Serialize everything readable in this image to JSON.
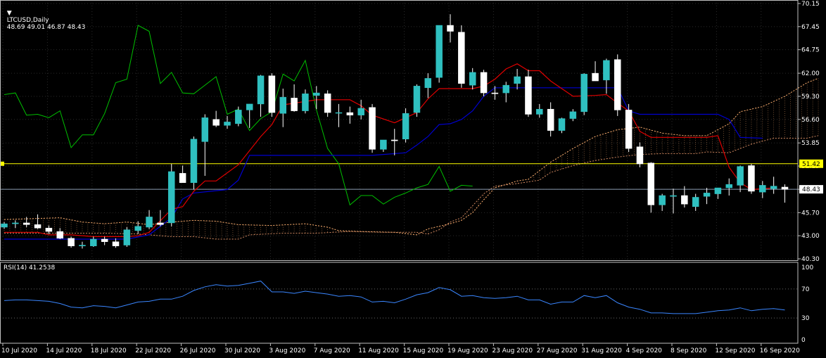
{
  "header": {
    "symbol_label": "LTCUSD,Daily",
    "ohlc_label": "48.69 49.01 46.87 48.43",
    "rsi_label": "RSI(14) 41.2538"
  },
  "colors": {
    "background": "#000000",
    "frame": "#c0c0c0",
    "grid": "#2a2a2a",
    "bull": "#2fc0c0",
    "bear": "#ffffff",
    "tenkan": "#e00000",
    "kijun": "#0000d0",
    "chikou": "#00c000",
    "span_a": "#ffb070",
    "span_b": "#d08860",
    "rsi": "#3a86ff",
    "marker_line": "#ffff00",
    "current_line": "#8a9bb0"
  },
  "price_axis": {
    "ticks": [
      "70.15",
      "67.45",
      "64.75",
      "62.00",
      "59.30",
      "56.60",
      "53.85",
      "51.15",
      "48.43",
      "45.70",
      "43.00",
      "40.30"
    ],
    "marker_label": "51.42",
    "current_label": "48.43"
  },
  "rsi_axis": {
    "ticks": [
      "100",
      "70",
      "30",
      "0"
    ]
  },
  "x_axis": {
    "labels": [
      "10 Jul 2020",
      "14 Jul 2020",
      "18 Jul 2020",
      "22 Jul 2020",
      "26 Jul 2020",
      "30 Jul 2020",
      "3 Aug 2020",
      "7 Aug 2020",
      "11 Aug 2020",
      "15 Aug 2020",
      "19 Aug 2020",
      "23 Aug 2020",
      "27 Aug 2020",
      "31 Aug 2020",
      "4 Sep 2020",
      "8 Sep 2020",
      "12 Sep 2020",
      "16 Sep 2020"
    ]
  },
  "chart_data": {
    "type": "candlestick",
    "title": "LTCUSD,Daily",
    "ylim": [
      40.3,
      70.15
    ],
    "rsi_ylim": [
      0,
      100
    ],
    "horizontal_line": 51.42,
    "current_price": 48.43,
    "ohlc": [
      [
        44.0,
        44.6,
        43.8,
        44.4
      ],
      [
        44.4,
        44.8,
        43.9,
        44.5
      ],
      [
        44.5,
        45.2,
        44.0,
        44.3
      ],
      [
        44.3,
        45.5,
        43.8,
        43.9
      ],
      [
        43.9,
        44.2,
        43.2,
        43.5
      ],
      [
        43.5,
        43.9,
        42.6,
        42.7
      ],
      [
        42.7,
        42.9,
        41.6,
        41.8
      ],
      [
        41.8,
        42.3,
        41.5,
        41.9
      ],
      [
        41.8,
        42.9,
        41.7,
        42.6
      ],
      [
        42.6,
        42.9,
        41.9,
        42.3
      ],
      [
        42.3,
        42.7,
        41.6,
        41.8
      ],
      [
        41.9,
        44.0,
        41.7,
        43.7
      ],
      [
        43.6,
        44.7,
        43.2,
        44.1
      ],
      [
        44.0,
        46.0,
        43.8,
        45.2
      ],
      [
        44.5,
        46.0,
        44.1,
        44.3
      ],
      [
        44.5,
        51.4,
        44.1,
        50.5
      ],
      [
        50.3,
        51.2,
        49.2,
        49.2
      ],
      [
        49.2,
        54.6,
        48.4,
        54.3
      ],
      [
        54.0,
        57.2,
        50.0,
        56.8
      ],
      [
        56.6,
        57.6,
        55.7,
        55.9
      ],
      [
        55.9,
        57.0,
        55.5,
        56.3
      ],
      [
        56.1,
        58.1,
        55.8,
        57.7
      ],
      [
        57.7,
        58.4,
        55.6,
        58.4
      ],
      [
        58.4,
        61.8,
        56.9,
        61.7
      ],
      [
        61.7,
        62.0,
        56.9,
        57.4
      ],
      [
        57.3,
        60.2,
        55.7,
        59.2
      ],
      [
        59.1,
        60.7,
        57.5,
        57.6
      ],
      [
        57.6,
        60.1,
        57.3,
        59.6
      ],
      [
        59.4,
        60.5,
        57.8,
        59.7
      ],
      [
        59.6,
        60.0,
        56.9,
        57.4
      ],
      [
        57.4,
        58.4,
        55.7,
        57.4
      ],
      [
        57.4,
        58.1,
        56.1,
        57.1
      ],
      [
        57.1,
        58.9,
        56.6,
        57.9
      ],
      [
        58.0,
        58.4,
        52.7,
        53.1
      ],
      [
        53.1,
        54.2,
        52.8,
        54.2
      ],
      [
        54.2,
        55.5,
        52.4,
        54.1
      ],
      [
        54.3,
        57.9,
        53.9,
        57.3
      ],
      [
        57.4,
        60.7,
        56.9,
        60.5
      ],
      [
        60.3,
        62.0,
        59.1,
        61.4
      ],
      [
        61.5,
        67.6,
        60.9,
        67.6
      ],
      [
        67.6,
        68.9,
        65.6,
        66.9
      ],
      [
        66.8,
        67.6,
        60.3,
        60.8
      ],
      [
        60.6,
        62.6,
        60.1,
        62.1
      ],
      [
        62.1,
        62.4,
        59.3,
        59.7
      ],
      [
        59.7,
        60.5,
        58.9,
        59.6
      ],
      [
        59.7,
        61.0,
        58.6,
        60.6
      ],
      [
        60.8,
        62.5,
        60.1,
        61.6
      ],
      [
        61.6,
        62.4,
        56.9,
        57.2
      ],
      [
        57.2,
        58.4,
        56.8,
        57.8
      ],
      [
        57.8,
        58.6,
        54.6,
        55.3
      ],
      [
        55.3,
        56.8,
        55.0,
        56.7
      ],
      [
        56.7,
        57.8,
        56.4,
        57.5
      ],
      [
        57.5,
        62.0,
        57.1,
        61.9
      ],
      [
        62.0,
        63.4,
        61.1,
        61.1
      ],
      [
        61.2,
        63.7,
        59.6,
        63.5
      ],
      [
        63.6,
        64.2,
        57.0,
        57.7
      ],
      [
        57.7,
        58.4,
        52.8,
        53.2
      ],
      [
        53.4,
        53.9,
        51.0,
        51.4
      ],
      [
        51.5,
        51.6,
        45.7,
        46.6
      ],
      [
        46.6,
        47.9,
        45.9,
        47.7
      ],
      [
        47.6,
        48.5,
        45.6,
        47.7
      ],
      [
        47.7,
        48.8,
        46.3,
        46.7
      ],
      [
        46.4,
        47.9,
        45.9,
        47.5
      ],
      [
        47.6,
        48.6,
        46.7,
        48.0
      ],
      [
        47.9,
        48.6,
        47.3,
        48.6
      ],
      [
        48.6,
        49.7,
        47.7,
        49.0
      ],
      [
        48.9,
        51.2,
        48.1,
        51.1
      ],
      [
        51.2,
        51.4,
        47.9,
        48.2
      ],
      [
        48.1,
        49.4,
        47.4,
        48.9
      ],
      [
        48.5,
        49.9,
        47.9,
        48.8
      ],
      [
        48.69,
        49.01,
        46.87,
        48.43
      ]
    ],
    "tenkan": [
      [
        0,
        43.4
      ],
      [
        3,
        43.4
      ],
      [
        4,
        43.1
      ],
      [
        6,
        43.1
      ],
      [
        8,
        42.9
      ],
      [
        11,
        42.9
      ],
      [
        12,
        43.0
      ],
      [
        13,
        43.4
      ],
      [
        15,
        46.1
      ],
      [
        16,
        46.4
      ],
      [
        17,
        48.2
      ],
      [
        18,
        49.4
      ],
      [
        19,
        49.4
      ],
      [
        21,
        51.3
      ],
      [
        23,
        54.6
      ],
      [
        24,
        56.0
      ],
      [
        25,
        58.3
      ],
      [
        28,
        58.9
      ],
      [
        31,
        58.9
      ],
      [
        32,
        58.2
      ],
      [
        33,
        57.1
      ],
      [
        35,
        56.2
      ],
      [
        37,
        57.4
      ],
      [
        38,
        59.0
      ],
      [
        39,
        60.2
      ],
      [
        42,
        60.2
      ],
      [
        43,
        60.5
      ],
      [
        44,
        61.3
      ],
      [
        45,
        62.5
      ],
      [
        46,
        63.1
      ],
      [
        47,
        62.3
      ],
      [
        48,
        62.3
      ],
      [
        49,
        61.1
      ],
      [
        51,
        59.3
      ],
      [
        53,
        59.4
      ],
      [
        54,
        59.5
      ],
      [
        55,
        58.5
      ],
      [
        56,
        57.6
      ],
      [
        57,
        55.2
      ],
      [
        58,
        54.5
      ],
      [
        61,
        54.5
      ],
      [
        62,
        54.5
      ],
      [
        63,
        54.5
      ],
      [
        64,
        54.7
      ],
      [
        65,
        51.0
      ],
      [
        66,
        49.2
      ],
      [
        67,
        48.4
      ],
      [
        69,
        48.6
      ]
    ],
    "kijun": [
      [
        0,
        42.6
      ],
      [
        11,
        42.6
      ],
      [
        13,
        43.1
      ],
      [
        15,
        45.1
      ],
      [
        16,
        47.3
      ],
      [
        17,
        48.0
      ],
      [
        20,
        48.4
      ],
      [
        21,
        49.5
      ],
      [
        22,
        52.4
      ],
      [
        29,
        52.4
      ],
      [
        33,
        52.4
      ],
      [
        36,
        52.7
      ],
      [
        37,
        53.6
      ],
      [
        38,
        54.6
      ],
      [
        39,
        56.0
      ],
      [
        40,
        56.1
      ],
      [
        41,
        56.6
      ],
      [
        42,
        57.6
      ],
      [
        43,
        59.3
      ],
      [
        44,
        60.3
      ],
      [
        53,
        60.3
      ],
      [
        55,
        60.3
      ],
      [
        56,
        57.6
      ],
      [
        57,
        57.2
      ],
      [
        64,
        57.2
      ],
      [
        65,
        56.6
      ],
      [
        66,
        54.5
      ],
      [
        68,
        54.4
      ]
    ],
    "chikou": [
      [
        0,
        59.5
      ],
      [
        1,
        59.7
      ],
      [
        2,
        57.1
      ],
      [
        3,
        57.2
      ],
      [
        4,
        56.8
      ],
      [
        5,
        57.6
      ],
      [
        6,
        53.3
      ],
      [
        7,
        54.8
      ],
      [
        8,
        54.8
      ],
      [
        9,
        57.3
      ],
      [
        10,
        60.9
      ],
      [
        11,
        61.3
      ],
      [
        12,
        67.6
      ],
      [
        13,
        66.9
      ],
      [
        14,
        60.8
      ],
      [
        15,
        62.1
      ],
      [
        16,
        59.7
      ],
      [
        17,
        59.6
      ],
      [
        18,
        60.6
      ],
      [
        19,
        61.6
      ],
      [
        20,
        57.2
      ],
      [
        21,
        57.8
      ],
      [
        22,
        55.3
      ],
      [
        23,
        56.7
      ],
      [
        24,
        57.5
      ],
      [
        25,
        61.9
      ],
      [
        26,
        61.1
      ],
      [
        27,
        63.5
      ],
      [
        28,
        57.7
      ],
      [
        29,
        53.2
      ],
      [
        30,
        51.4
      ],
      [
        31,
        46.6
      ],
      [
        32,
        47.7
      ],
      [
        33,
        47.7
      ],
      [
        34,
        46.7
      ],
      [
        35,
        47.5
      ],
      [
        36,
        48.0
      ],
      [
        37,
        48.6
      ],
      [
        38,
        49.0
      ],
      [
        39,
        51.1
      ],
      [
        40,
        48.2
      ],
      [
        41,
        48.9
      ],
      [
        42,
        48.8
      ]
    ],
    "span_a": [
      [
        0,
        44.9
      ],
      [
        5,
        45.1
      ],
      [
        7,
        44.6
      ],
      [
        9,
        44.4
      ],
      [
        11,
        44.6
      ],
      [
        13,
        44.3
      ],
      [
        15,
        44.6
      ],
      [
        17,
        44.8
      ],
      [
        19,
        44.7
      ],
      [
        21,
        44.3
      ],
      [
        24,
        44.2
      ],
      [
        27,
        44.4
      ],
      [
        29,
        44.0
      ],
      [
        30,
        43.6
      ],
      [
        32,
        43.5
      ],
      [
        35,
        43.4
      ],
      [
        37,
        43.1
      ],
      [
        38,
        43.8
      ],
      [
        40,
        44.4
      ],
      [
        41,
        44.8
      ],
      [
        42,
        45.7
      ],
      [
        43,
        47.2
      ],
      [
        44,
        48.6
      ],
      [
        45,
        49.0
      ],
      [
        46,
        49.4
      ],
      [
        47,
        49.6
      ],
      [
        49,
        51.6
      ],
      [
        51,
        53.2
      ],
      [
        53,
        54.6
      ],
      [
        55,
        55.4
      ],
      [
        57,
        55.7
      ],
      [
        59,
        55.0
      ],
      [
        61,
        54.7
      ],
      [
        63,
        54.7
      ],
      [
        65,
        56.1
      ],
      [
        66,
        57.5
      ],
      [
        68,
        58.1
      ],
      [
        70,
        59.3
      ],
      [
        72,
        60.9
      ],
      [
        73,
        61.4
      ]
    ],
    "span_b": [
      [
        0,
        43.3
      ],
      [
        9,
        43.3
      ],
      [
        12,
        43.2
      ],
      [
        14,
        43.0
      ],
      [
        15,
        42.9
      ],
      [
        17,
        42.9
      ],
      [
        19,
        42.6
      ],
      [
        21,
        42.6
      ],
      [
        22,
        43.1
      ],
      [
        25,
        43.3
      ],
      [
        28,
        43.3
      ],
      [
        31,
        43.5
      ],
      [
        34,
        43.4
      ],
      [
        37,
        43.4
      ],
      [
        38,
        43.2
      ],
      [
        39,
        43.7
      ],
      [
        40,
        44.6
      ],
      [
        41,
        45.1
      ],
      [
        42,
        46.5
      ],
      [
        43,
        47.9
      ],
      [
        44,
        48.8
      ],
      [
        46,
        49.1
      ],
      [
        48,
        49.5
      ],
      [
        49,
        50.4
      ],
      [
        51,
        51.2
      ],
      [
        53,
        51.8
      ],
      [
        55,
        52.2
      ],
      [
        57,
        52.5
      ],
      [
        59,
        52.6
      ],
      [
        62,
        52.6
      ],
      [
        63,
        52.8
      ],
      [
        65,
        52.7
      ],
      [
        67,
        53.7
      ],
      [
        69,
        54.4
      ],
      [
        72,
        54.4
      ],
      [
        73,
        54.7
      ]
    ],
    "rsi": [
      54,
      55,
      55,
      54,
      53,
      50,
      45,
      44,
      47,
      46,
      44,
      48,
      52,
      53,
      56,
      56,
      60,
      68,
      73,
      76,
      74,
      75,
      78,
      81,
      66,
      66,
      64,
      67,
      65,
      63,
      60,
      61,
      59,
      52,
      53,
      51,
      56,
      62,
      65,
      72,
      69,
      60,
      61,
      58,
      57,
      58,
      60,
      55,
      55,
      49,
      52,
      52,
      61,
      58,
      61,
      51,
      45,
      42,
      37,
      37,
      36,
      36,
      36,
      38,
      40,
      41,
      44,
      40,
      42,
      43,
      41
    ]
  }
}
